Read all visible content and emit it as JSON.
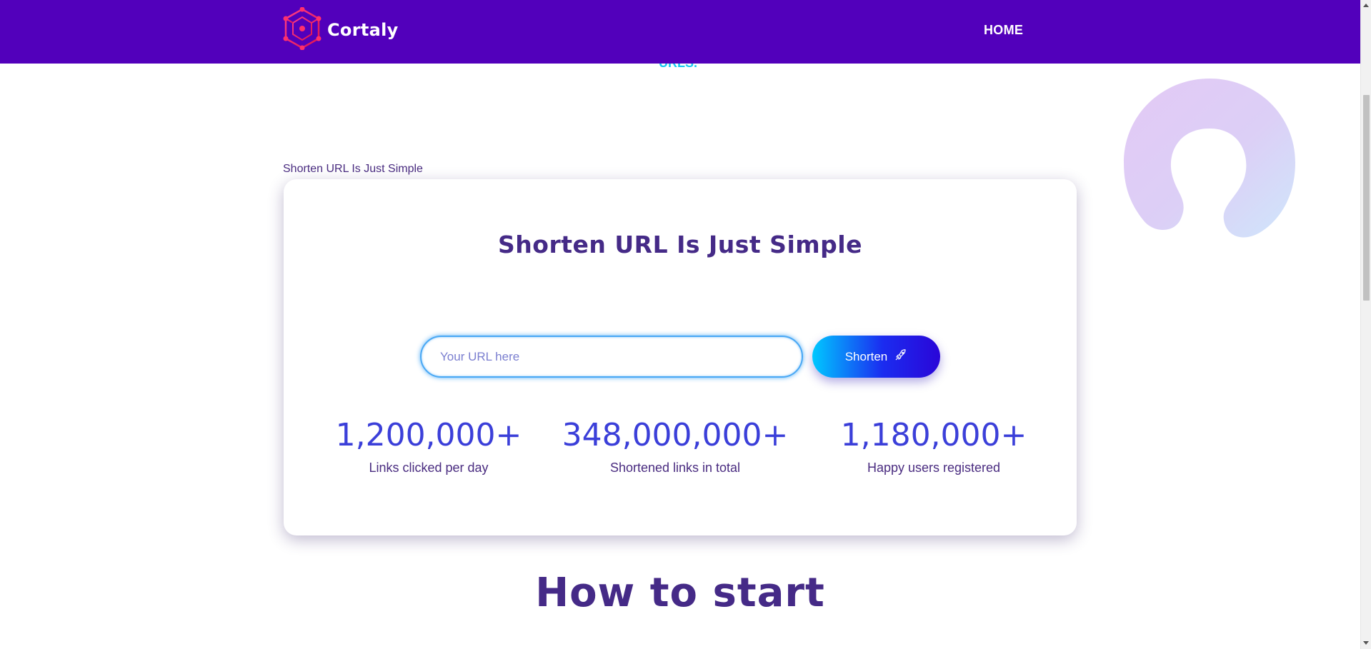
{
  "header": {
    "brand_name": "Cortaly",
    "nav_home": "HOME",
    "logo_icon": "hexagon-network-logo-icon",
    "background_color": "#5200bb"
  },
  "peek_text": "URLS.",
  "section_label": "Shorten URL Is Just Simple",
  "card": {
    "title": "Shorten URL Is Just Simple",
    "input_placeholder": "Your URL here",
    "input_value": "",
    "shorten_label": "Shorten",
    "shorten_icon": "rocket-icon",
    "stats": [
      {
        "value": "1,200,000+",
        "label": "Links clicked per day"
      },
      {
        "value": "348,000,000+",
        "label": "Shortened links in total"
      },
      {
        "value": "1,180,000+",
        "label": "Happy users registered"
      }
    ]
  },
  "how_to_start": "How to start",
  "colors": {
    "accent_cyan": "#19c8f0",
    "heading_purple": "#452a87",
    "stat_blue": "#3b3fd9",
    "button_gradient_start": "#00c8ff",
    "button_gradient_end": "#2a06d8"
  }
}
